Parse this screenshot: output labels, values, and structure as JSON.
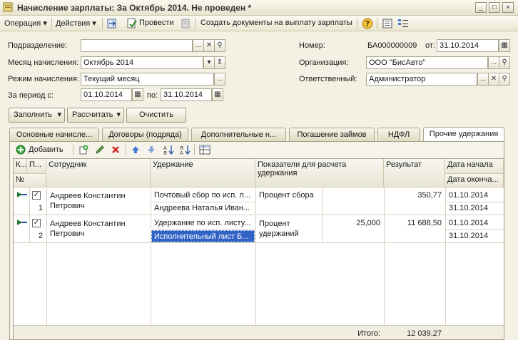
{
  "window": {
    "title": "Начисление зарплаты: За Октябрь 2014. Не проведен *",
    "controls": [
      "_",
      "□",
      "×"
    ]
  },
  "toolbar": {
    "operation": "Операция",
    "actions": "Действия",
    "post": "Провести",
    "create_payment_docs": "Создать документы на выплату зарплаты"
  },
  "form": {
    "subdivision_label": "Подразделение:",
    "subdivision_value": "",
    "month_label": "Месяц начисления:",
    "month_value": "Октябрь 2014",
    "mode_label": "Режим начисления:",
    "mode_value": "Текущий месяц",
    "period_from_label": "За период с:",
    "period_from_value": "01.10.2014",
    "period_to_label": "по:",
    "period_to_value": "31.10.2014",
    "number_label": "Номер:",
    "number_value": "БА000000009",
    "date_label": "от:",
    "date_value": "31.10.2014",
    "organization_label": "Организация:",
    "organization_value": "ООО \"БисАвто\"",
    "responsible_label": "Ответственный:",
    "responsible_value": "Администратор"
  },
  "buttons": {
    "fill": "Заполнить",
    "calculate": "Рассчитать",
    "clear": "Очистить"
  },
  "tabs": [
    {
      "label": "Основные начисле..."
    },
    {
      "label": "Договоры (подряда)"
    },
    {
      "label": "Дополнительные н..."
    },
    {
      "label": "Погашение займов"
    },
    {
      "label": "НДФЛ"
    },
    {
      "label": "Прочие удержания"
    }
  ],
  "grid_toolbar": {
    "add": "Добавить"
  },
  "grid": {
    "headers": {
      "k": "К...",
      "p": "П...",
      "no": "№",
      "employee": "Сотрудник",
      "deduction": "Удержание",
      "indicators": "Показатели для расчета удержания",
      "result": "Результат",
      "date_start": "Дата начала",
      "date_end": "Дата оконча..."
    },
    "rows": [
      {
        "no": "1",
        "employee": "Андреев Константин Петрович",
        "deduction": "Почтовый сбор по исп. л...",
        "deduction2": "Андреева Наталья Иван...",
        "indicator": "Процент сбора",
        "indicator_value": "",
        "result": "350,77",
        "date_start": "01.10.2014",
        "date_end": "31.10.2014"
      },
      {
        "no": "2",
        "employee": "Андреев Константин Петрович",
        "deduction": "Удержание по исп. листу...",
        "deduction2": "Исполнительный лист Б...",
        "indicator": "Процент удержаний",
        "indicator_value": "25,000",
        "result": "11 688,50",
        "date_start": "01.10.2014",
        "date_end": "31.10.2014"
      }
    ],
    "total_label": "Итого:",
    "total_value": "12 039,27"
  }
}
